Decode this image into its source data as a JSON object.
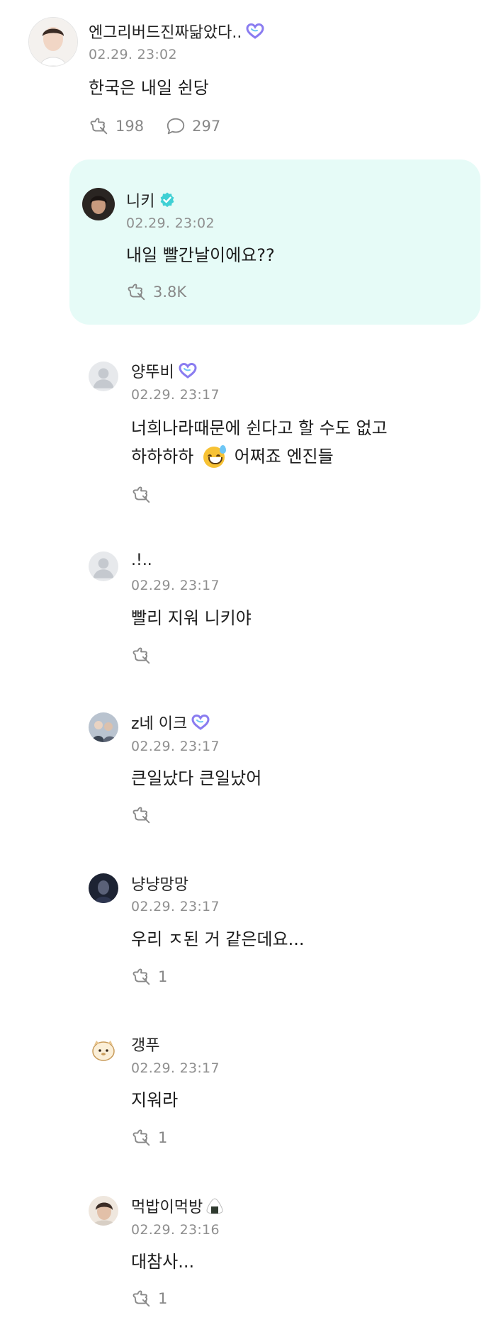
{
  "colors": {
    "accent_badge": "#8a7cf0",
    "verified": "#3fd0d4",
    "reply_bg": "#e6fbf7",
    "meta_gray": "#8f8f8f"
  },
  "main_post": {
    "author": "엔그리버드진짜닮았다..",
    "date": "02.29. 23:02",
    "text": "한국은 내일 쉰당",
    "likes": "198",
    "comments": "297"
  },
  "artist_reply": {
    "author": "니키",
    "date": "02.29. 23:02",
    "text": "내일 빨간날이에요??",
    "likes": "3.8K"
  },
  "comments": [
    {
      "author": "양뚜비",
      "date": "02.29. 23:17",
      "line1": "너희나라때문에 쉰다고 할 수도 없고",
      "line2_pre": "하하하하",
      "line2_post": "어쩌죠 엔진들",
      "likes": ""
    },
    {
      "author": ".!..",
      "date": "02.29. 23:17",
      "text": "빨리 지워 니키야",
      "likes": ""
    },
    {
      "author": "z네 이크",
      "date": "02.29. 23:17",
      "text": "큰일났다 큰일났어",
      "likes": ""
    },
    {
      "author": "냥냥망망",
      "date": "02.29. 23:17",
      "text": "우리 ㅈ된 거 같은데요...",
      "likes": "1"
    },
    {
      "author": "갱푸",
      "date": "02.29. 23:17",
      "text": "지워라",
      "likes": "1"
    },
    {
      "author": "먹밥이먹방",
      "date": "02.29. 23:16",
      "text": "대참사...",
      "likes": "1"
    }
  ]
}
